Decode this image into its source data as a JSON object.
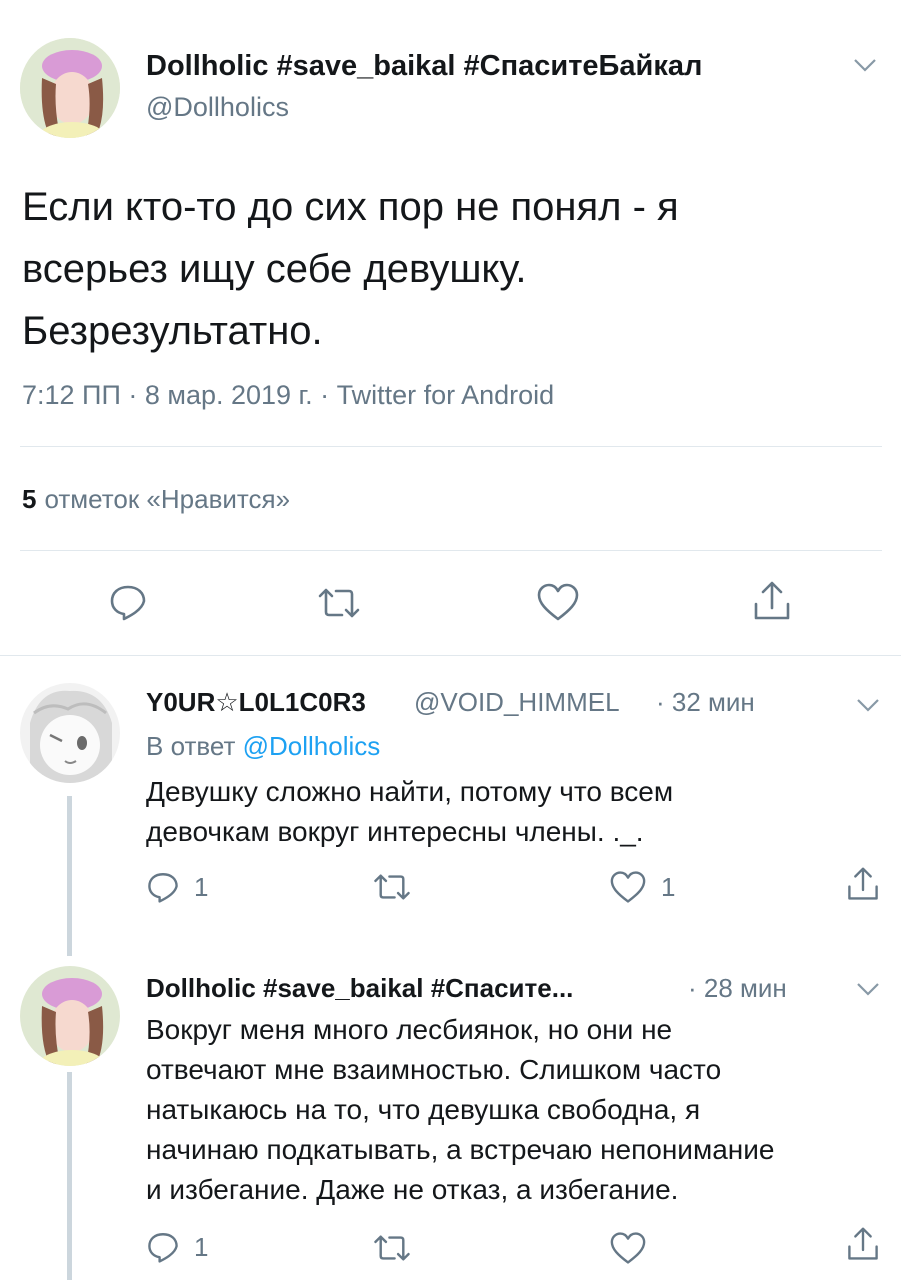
{
  "main_tweet": {
    "display_name": "Dollholic #save_baikal #СпаситеБайкал",
    "handle": "@Dollholics",
    "text_lines": [
      "Если кто-то до сих пор не понял - я",
      "всерьез ищу себе девушку.",
      "Безрезультатно."
    ],
    "meta": "7:12 ПП · 8 мар. 2019 г. · Twitter for Android",
    "likes_count": "5",
    "likes_label": "отметок «Нравится»",
    "actions": {
      "reply_icon": "reply-icon",
      "retweet_icon": "retweet-icon",
      "like_icon": "heart-icon",
      "share_icon": "share-icon"
    }
  },
  "replies": [
    {
      "display_name": "Y0UR☆L0L1C0R3",
      "handle": "@VOID_HIMMEL",
      "time": "· 32 мин",
      "reply_to_label": "В ответ",
      "reply_to_mention": "@Dollholics",
      "text_lines": [
        "Девушку сложно найти, потому что всем",
        "девочкам вокруг интересны члены. ._."
      ],
      "reply_count": "1",
      "like_count": "1"
    },
    {
      "display_name": "Dollholic #save_baikal #Спасите...",
      "time": "· 28 мин",
      "text_lines": [
        "Вокруг меня много лесбиянок, но они не",
        "отвечают мне взаимностью. Слишком часто",
        "натыкаюсь на то, что девушка свободна, я",
        "начинаю подкатывать, а встречаю непонимание",
        "и избегание. Даже не отказ, а избегание."
      ],
      "reply_count": "1"
    }
  ],
  "colors": {
    "text": "#14171a",
    "secondary": "#657786",
    "link": "#1da1f2",
    "divider": "#e1e8ed",
    "thread_line": "#ccd6dd"
  }
}
